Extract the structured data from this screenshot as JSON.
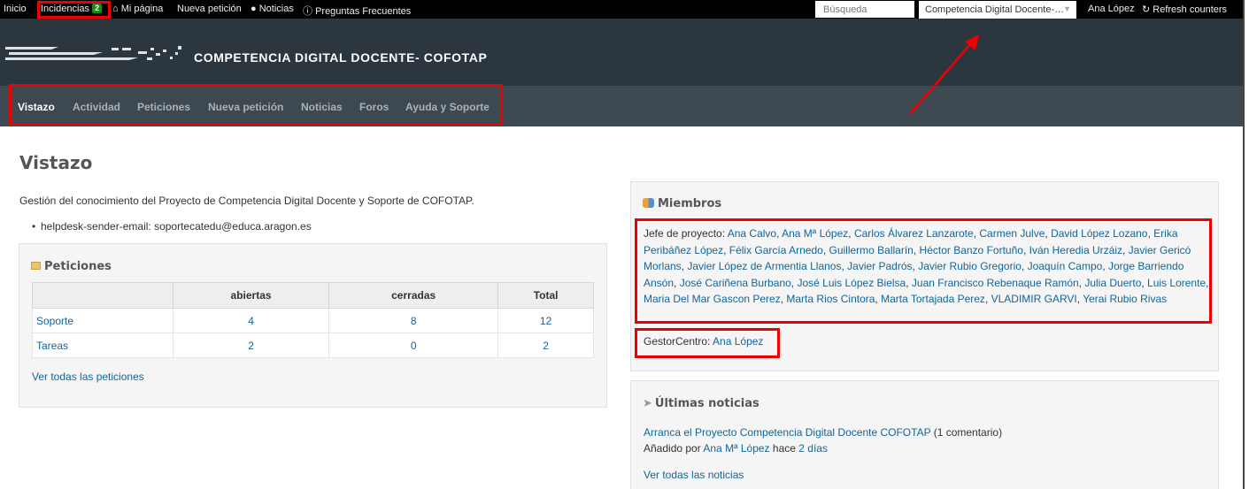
{
  "top_menu": {
    "home": "Inicio",
    "incidencias": "Incidencias",
    "incidencias_count": "2",
    "my_page": "Mi página",
    "new_issue": "Nueva petición",
    "news": "Noticias",
    "faq": "Preguntas Frecuentes",
    "search_placeholder": "Búsqueda",
    "project_selected": "Competencia Digital Docente-…",
    "user": "Ana López",
    "refresh": "Refresh counters"
  },
  "header": {
    "title": "COMPETENCIA DIGITAL DOCENTE- COFOTAP"
  },
  "main_menu": {
    "tabs": [
      "Vistazo",
      "Actividad",
      "Peticiones",
      "Nueva petición",
      "Noticias",
      "Foros",
      "Ayuda y Soporte"
    ],
    "selected": "Vistazo"
  },
  "page": {
    "title": "Vistazo",
    "description": "Gestión del conocimiento del Proyecto de Competencia Digital Docente y Soporte de COFOTAP.",
    "custom_field": "helpdesk-sender-email: soportecatedu@educa.aragon.es"
  },
  "issues": {
    "title": "Peticiones",
    "headers": [
      "",
      "abiertas",
      "cerradas",
      "Total"
    ],
    "rows": [
      {
        "label": "Soporte",
        "open": "4",
        "closed": "8",
        "total": "12"
      },
      {
        "label": "Tareas",
        "open": "2",
        "closed": "0",
        "total": "2"
      }
    ],
    "view_all": "Ver todas las peticiones"
  },
  "members": {
    "title": "Miembros",
    "role_label": "Jefe de proyecto:",
    "names": [
      "Ana Calvo",
      "Ana Mª López",
      "Carlos Álvarez Lanzarote",
      "Carmen Julve",
      "David López Lozano",
      "Erika Peribáñez López",
      "Félix García Arnedo",
      "Guillermo Ballarín",
      "Héctor Banzo Fortuño",
      "Iván Heredia Urzáiz",
      "Javier Gericó Morlans",
      "Javier López de Armentia Llanos",
      "Javier Padrós",
      "Javier Rubio Gregorio",
      "Joaquín Campo",
      "Jorge Barriendo Ansón",
      "José Cariñena Burbano",
      "José Luis López Bielsa",
      "Juan Francisco Rebenaque Ramón",
      "Julia Duerto",
      "Luis Lorente",
      "Maria Del Mar Gascon Perez",
      "Marta Rios Cintora",
      "Marta Tortajada Perez",
      "VLADIMIR GARVI",
      "Yerai Rubio Rivas"
    ],
    "gestor_label": "GestorCentro:",
    "gestor_name": "Ana López"
  },
  "news": {
    "title": "Últimas noticias",
    "item_title": "Arranca el Proyecto Competencia Digital Docente COFOTAP",
    "item_comments": "(1 comentario)",
    "added_by": "Añadido por",
    "author": "Ana Mª López",
    "hace": "hace",
    "age": "2 días",
    "view_all": "Ver todas las noticias"
  }
}
